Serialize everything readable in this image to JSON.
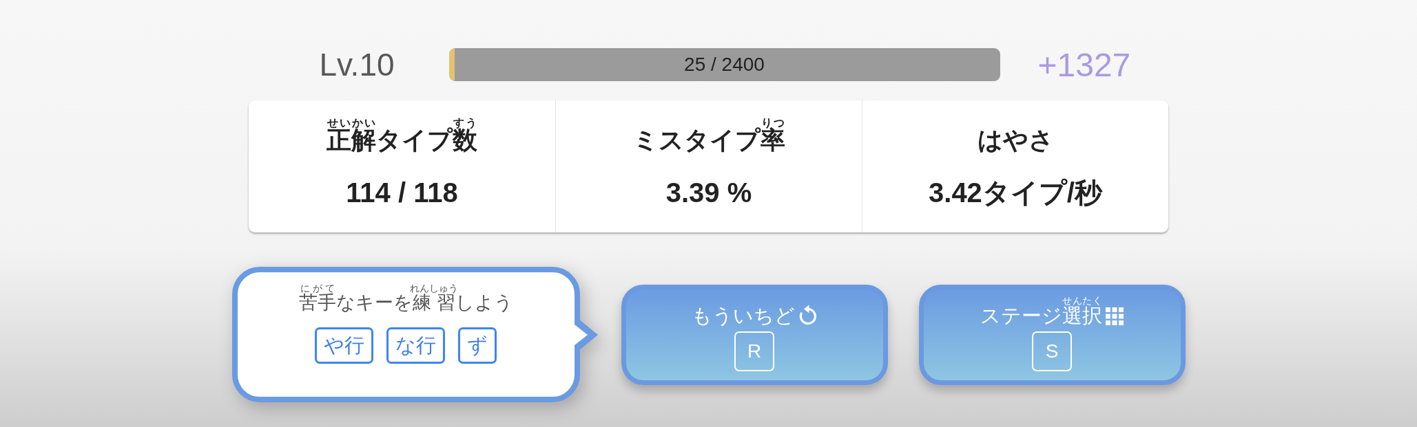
{
  "level": {
    "label": "Lv.10",
    "progress": {
      "text": "25 / 2400",
      "level": 0.0104
    },
    "gain": "+1327"
  },
  "stats": [
    {
      "title": [
        {
          "text": "正解",
          "ruby": "せいかい"
        },
        {
          "text": "タイプ"
        },
        {
          "text": "数",
          "ruby": "すう"
        }
      ],
      "value": "114 / 118"
    },
    {
      "title": [
        {
          "text": "ミスタイプ"
        },
        {
          "text": "率",
          "ruby": "りつ"
        }
      ],
      "value": "3.39 %"
    },
    {
      "title": [
        {
          "text": "はやさ"
        }
      ],
      "value": "3.42タイプ/秒"
    }
  ],
  "advice": {
    "message": [
      {
        "text": "苦手",
        "ruby": "にがて"
      },
      {
        "text": "なキーを"
      },
      {
        "text": "練習",
        "ruby": "れんしゅう"
      },
      {
        "text": "しよう"
      }
    ],
    "weak_keys": [
      "や行",
      "な行",
      "ず"
    ]
  },
  "buttons": [
    {
      "kind": "retry",
      "label": [
        {
          "text": "もういちど"
        }
      ],
      "key": "R"
    },
    {
      "kind": "stage_select",
      "label": [
        {
          "text": "ステージ"
        },
        {
          "text": "選択",
          "ruby": "せんたく"
        }
      ],
      "key": "S"
    }
  ]
}
